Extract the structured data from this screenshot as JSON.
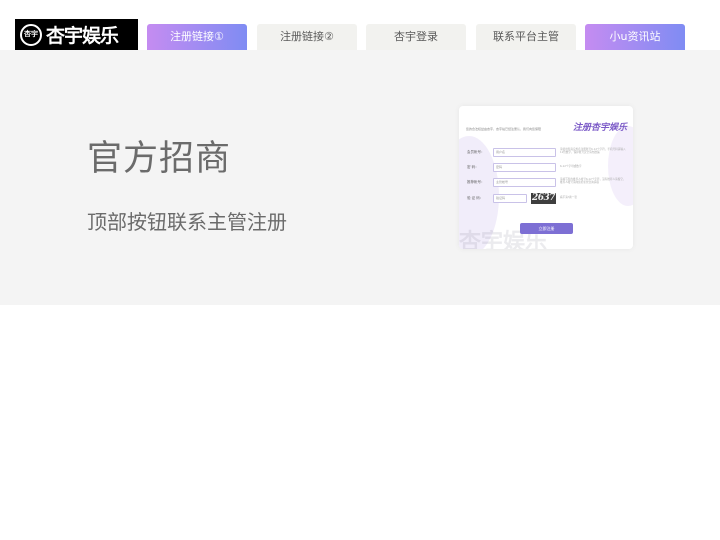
{
  "header": {
    "logo": {
      "emblem_text": "杏宇",
      "text": "杏宇娱乐"
    },
    "nav": [
      {
        "label": "注册链接①",
        "style": "gradient"
      },
      {
        "label": "注册链接②",
        "style": "plain"
      },
      {
        "label": "杏宇登录",
        "style": "plain"
      },
      {
        "label": "联系平台主管",
        "style": "plain"
      },
      {
        "label": "小u资讯站",
        "style": "gradient"
      }
    ]
  },
  "banner": {
    "title": "官方招商",
    "subtitle": "顶部按钮联系主管注册"
  },
  "form_card": {
    "title": "注册杏宇娱乐",
    "intro": "您的合法权益由杏宇，杏宇站已经注册认，我们向您保障",
    "fields": [
      {
        "label": "会员帐号：",
        "placeholder": "用户名",
        "hint": "请使用您真实姓名注册账号6-12个字符，手机号码请输入11位数字，保护账号安全请勿透漏"
      },
      {
        "label": "密  码：",
        "placeholder": "密码",
        "hint": "6-12个字母或数字"
      },
      {
        "label": "推荐帐号：",
        "placeholder": "主管帐号",
        "hint": "请填写您的推荐人帐号6-12个字符，没有推荐人请留空，推荐人帐号请向您的主管咨询获取"
      },
      {
        "label": "验 证 码：",
        "placeholder": "验证码",
        "captcha": "2637",
        "hint": "看不清?换一张"
      }
    ],
    "submit_label": "立即注册",
    "watermark": "杏宇娱乐"
  },
  "colors": {
    "gradient_start": "#c58cf1",
    "gradient_end": "#7f8cf3",
    "banner_bg": "#f4f4f4",
    "submit": "#7d6fd4"
  }
}
